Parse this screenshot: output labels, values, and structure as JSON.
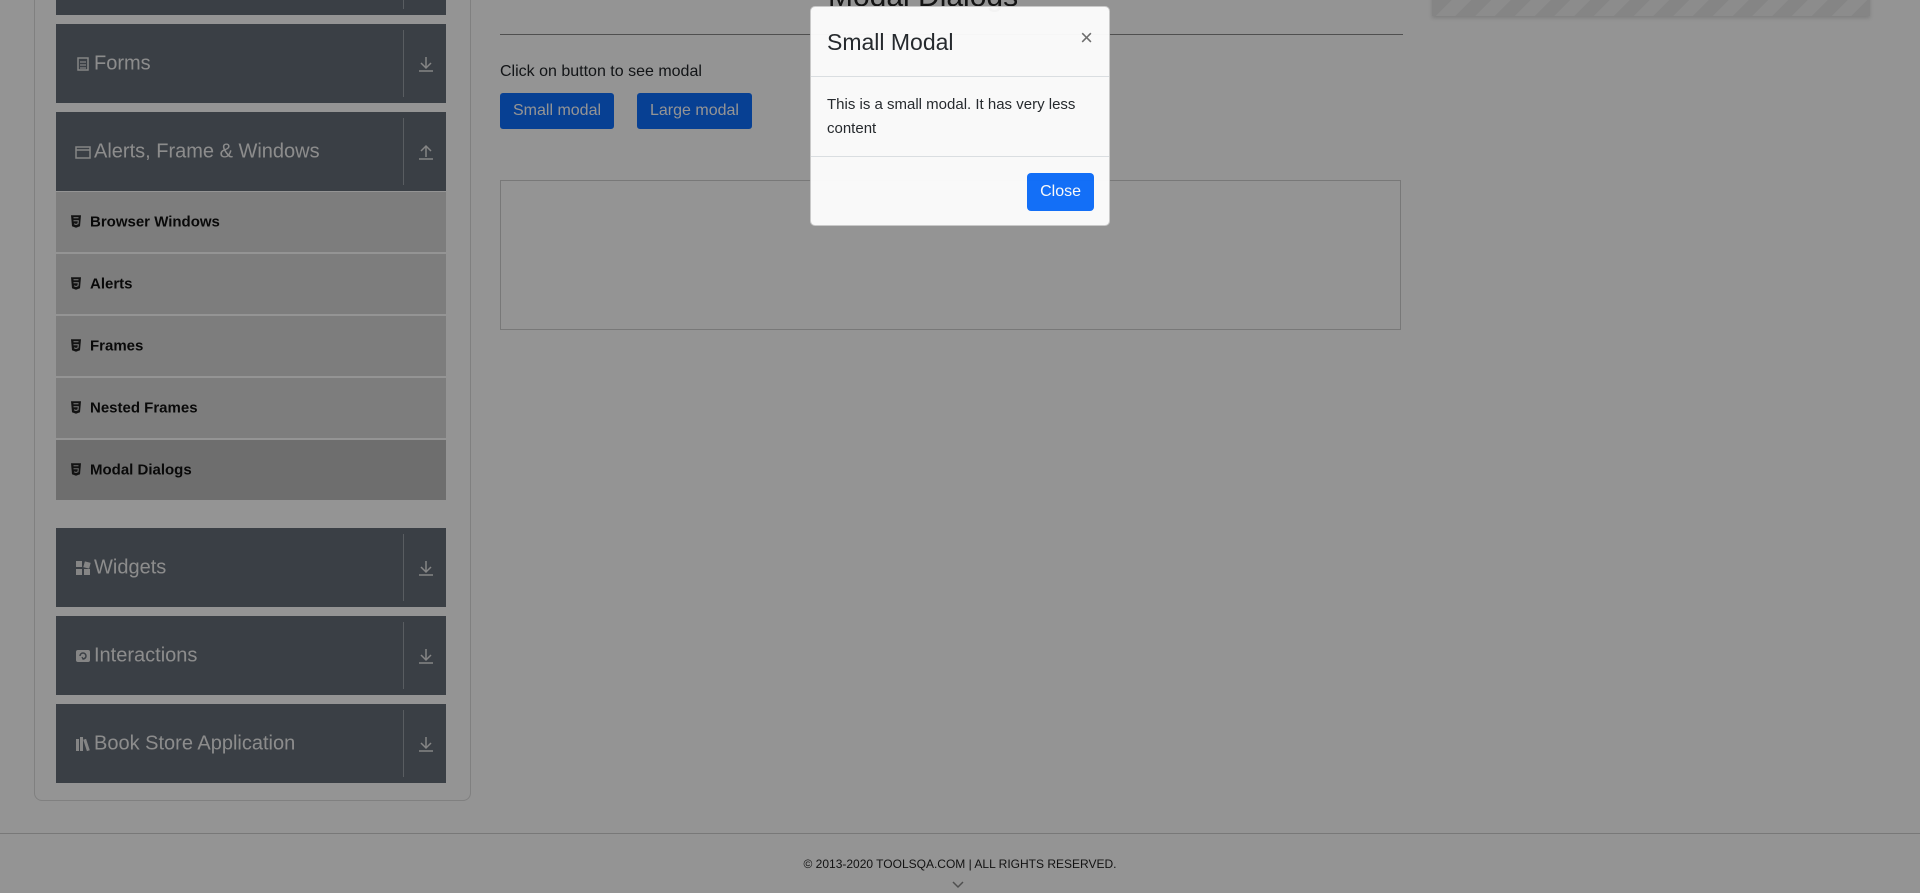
{
  "sidebar": {
    "groups": [
      {
        "title": "Forms",
        "icon": "forms-icon",
        "state": "collapsed"
      },
      {
        "title": "Alerts, Frame & Windows",
        "icon": "window-icon",
        "state": "expanded"
      },
      {
        "title": "Widgets",
        "icon": "widgets-icon",
        "state": "collapsed"
      },
      {
        "title": "Interactions",
        "icon": "interactions-icon",
        "state": "collapsed"
      },
      {
        "title": "Book Store Application",
        "icon": "bookstore-icon",
        "state": "collapsed"
      }
    ],
    "items": [
      {
        "label": "Browser Windows",
        "icon": "html5-icon"
      },
      {
        "label": "Alerts",
        "icon": "html5-icon"
      },
      {
        "label": "Frames",
        "icon": "html5-icon"
      },
      {
        "label": "Nested Frames",
        "icon": "html5-icon"
      },
      {
        "label": "Modal Dialogs",
        "icon": "html5-icon",
        "active": true
      }
    ]
  },
  "main": {
    "heading": "Modal Dialogs",
    "instruction": "Click on button to see modal",
    "small_modal_button": "Small modal",
    "large_modal_button": "Large modal"
  },
  "modal": {
    "title": "Small Modal",
    "close_symbol": "×",
    "body": "This is a small modal. It has very less content",
    "close_button": "Close"
  },
  "footer": {
    "text": "© 2013-2020 TOOLSQA.COM | ALL RIGHTS RESERVED."
  },
  "colors": {
    "sidebar_header": "#646d77",
    "menu_item": "#d8d8d8",
    "menu_item_active": "#bdbdbd",
    "primary": "#0d6efd"
  }
}
